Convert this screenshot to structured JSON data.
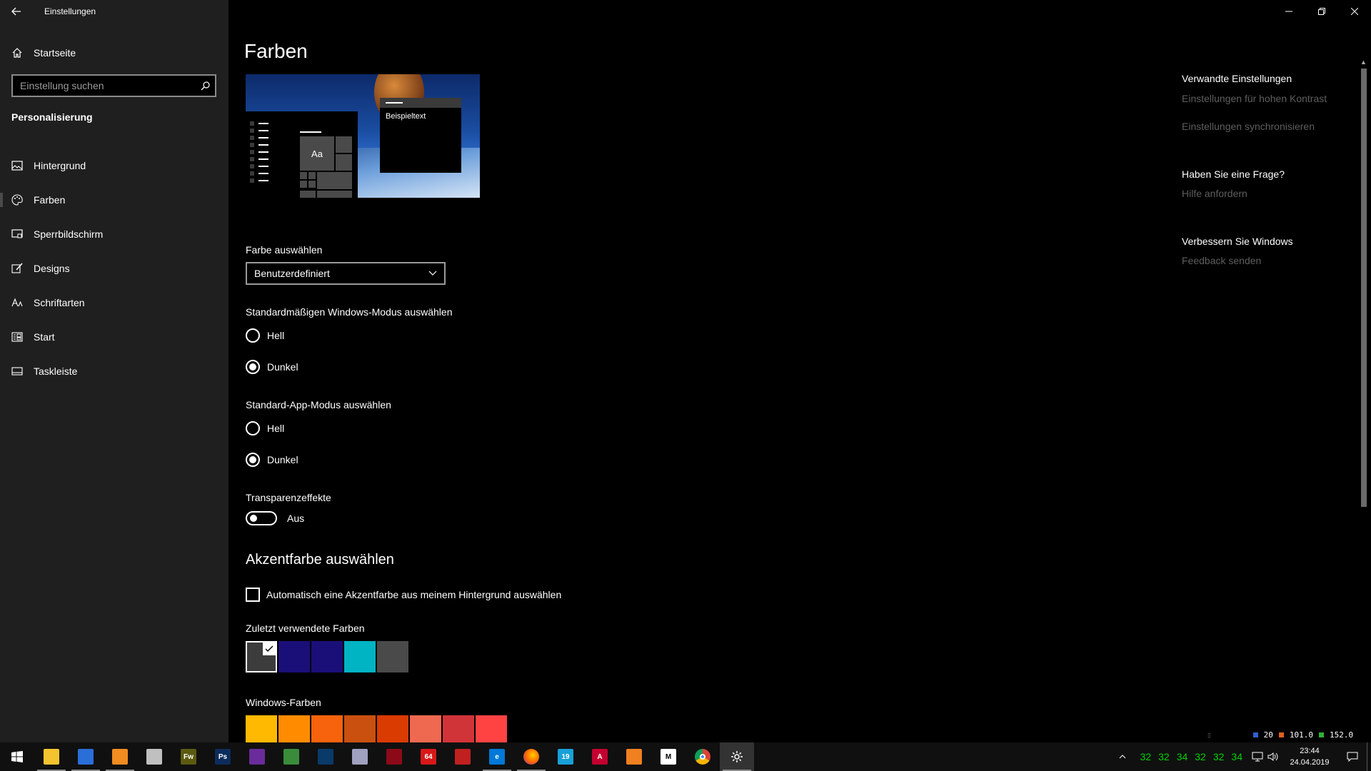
{
  "window": {
    "app_title": "Einstellungen"
  },
  "sidebar": {
    "home_label": "Startseite",
    "search_placeholder": "Einstellung suchen",
    "section_heading": "Personalisierung",
    "items": [
      {
        "label": "Hintergrund",
        "icon": "image-icon"
      },
      {
        "label": "Farben",
        "icon": "palette-icon",
        "active": true
      },
      {
        "label": "Sperrbildschirm",
        "icon": "lock-screen-icon"
      },
      {
        "label": "Designs",
        "icon": "brush-icon"
      },
      {
        "label": "Schriftarten",
        "icon": "font-icon"
      },
      {
        "label": "Start",
        "icon": "start-icon"
      },
      {
        "label": "Taskleiste",
        "icon": "taskbar-icon"
      }
    ]
  },
  "main": {
    "page_title": "Farben",
    "preview": {
      "sample_text": "Beispieltext",
      "tile_text": "Aa"
    },
    "color_choice": {
      "label": "Farbe auswählen",
      "selected": "Benutzerdefiniert"
    },
    "windows_mode": {
      "label": "Standardmäßigen Windows-Modus auswählen",
      "options": [
        "Hell",
        "Dunkel"
      ],
      "selected": "Dunkel"
    },
    "app_mode": {
      "label": "Standard-App-Modus auswählen",
      "options": [
        "Hell",
        "Dunkel"
      ],
      "selected": "Dunkel"
    },
    "transparency": {
      "label": "Transparenzeffekte",
      "state": "Aus"
    },
    "accent_title": "Akzentfarbe auswählen",
    "auto_accent_label": "Automatisch eine Akzentfarbe aus meinem Hintergrund auswählen",
    "recent_colors": {
      "label": "Zuletzt verwendete Farben",
      "colors": [
        "#3c3c3c",
        "#1a0f78",
        "#1a0f78",
        "#00b4c4",
        "#4a4a4a"
      ]
    },
    "windows_colors": {
      "label": "Windows-Farben",
      "colors": [
        "#ffb900",
        "#ff8c00",
        "#f7630c",
        "#ca5010",
        "#da3b01",
        "#ef6950",
        "#d13438",
        "#ff4343"
      ]
    }
  },
  "related": {
    "heading1": "Verwandte Einstellungen",
    "link1": "Einstellungen für hohen Kontrast",
    "link2": "Einstellungen synchronisieren",
    "heading2": "Haben Sie eine Frage?",
    "link3": "Hilfe anfordern",
    "heading3": "Verbessern Sie Windows",
    "link4": "Feedback senden"
  },
  "overlay": {
    "v1": "20",
    "v2": "101.0",
    "v3": "152.0"
  },
  "taskbar": {
    "apps": [
      {
        "name": "explorer",
        "color": "#f4c430"
      },
      {
        "name": "thunderbird",
        "color": "#2a6ed8"
      },
      {
        "name": "media-player",
        "color": "#f08c20"
      },
      {
        "name": "tools",
        "color": "#c0c0c0"
      },
      {
        "name": "fireworks",
        "label": "Fw",
        "color": "#5a5a10"
      },
      {
        "name": "photoshop",
        "label": "Ps",
        "color": "#0c2c5c"
      },
      {
        "name": "purple-app",
        "color": "#6a2c9a"
      },
      {
        "name": "maps",
        "color": "#3a8c3a"
      },
      {
        "name": "edge-dev",
        "color": "#0a3a6a"
      },
      {
        "name": "winrar",
        "color": "#a0a0c0"
      },
      {
        "name": "media-app",
        "color": "#8c0a18"
      },
      {
        "name": "app-64",
        "label": "64",
        "color": "#d81818"
      },
      {
        "name": "ccleaner",
        "color": "#c02020"
      },
      {
        "name": "edge",
        "label": "e",
        "color": "#0078d7"
      },
      {
        "name": "firefox",
        "color": "#ff6a00"
      },
      {
        "name": "app-19",
        "label": "19",
        "color": "#18a0d8"
      },
      {
        "name": "angular",
        "label": "A",
        "color": "#c3002f"
      },
      {
        "name": "feed",
        "color": "#f08020"
      },
      {
        "name": "gmail",
        "label": "M",
        "color": "#ffffff"
      },
      {
        "name": "chrome",
        "color": "#e0a020"
      },
      {
        "name": "settings",
        "color": "#333333"
      }
    ],
    "temps": [
      "32",
      "32",
      "34",
      "32",
      "32",
      "34"
    ],
    "time": "23:44",
    "date": "24.04.2019"
  }
}
